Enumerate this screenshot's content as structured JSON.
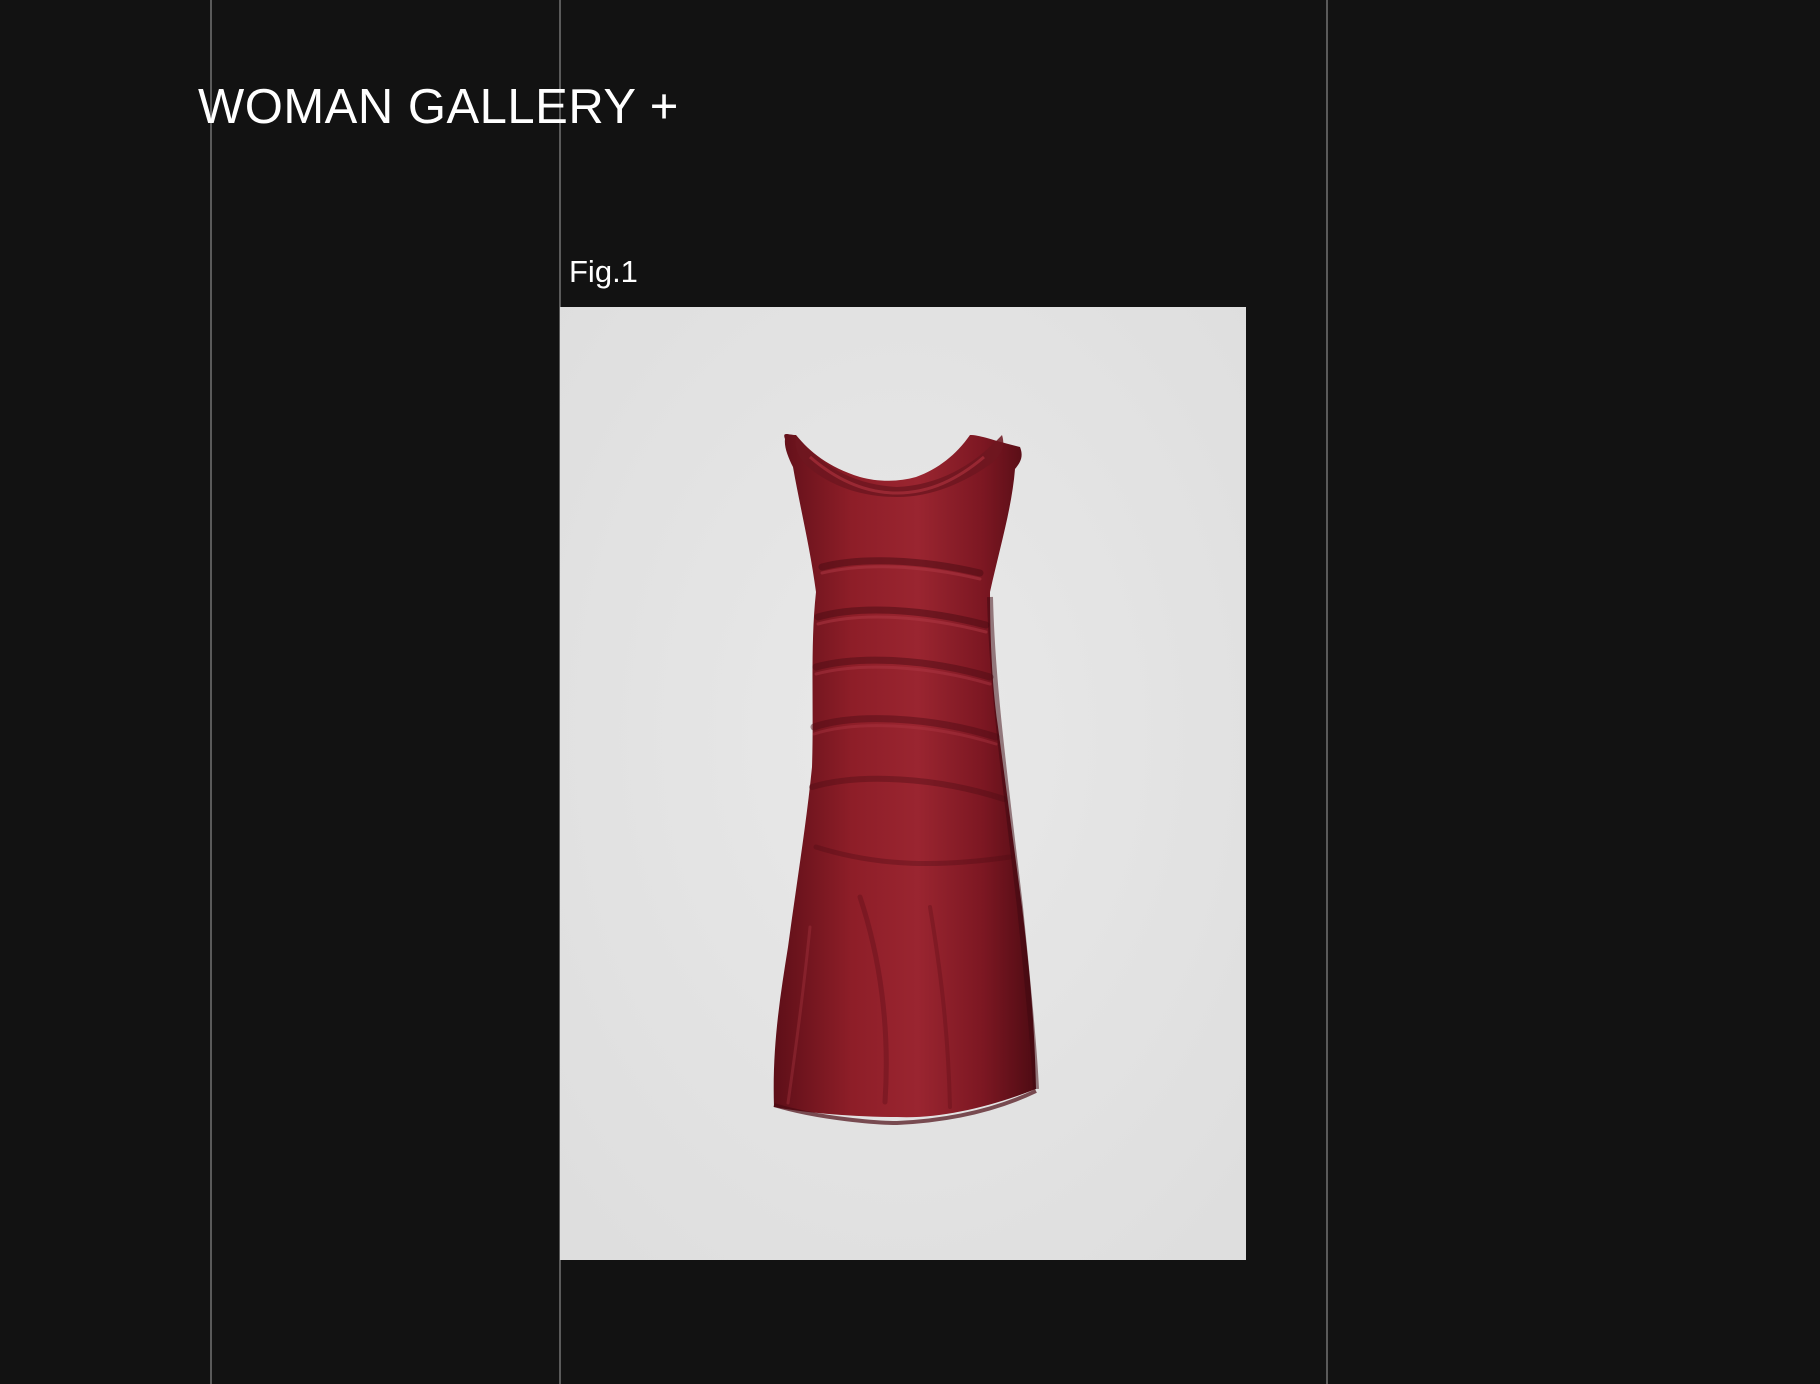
{
  "header": {
    "title": "WOMAN GALLERY +"
  },
  "gallery": {
    "items": [
      {
        "label": "Fig.1",
        "image_subject": "burgundy ruched draped-neck midi dress",
        "image_background": "#e4e4e4",
        "garment_color": "#8a1c26"
      }
    ]
  },
  "colors": {
    "page_background": "#121212",
    "grid_lines": "#5a5a5a",
    "text": "#ffffff"
  }
}
